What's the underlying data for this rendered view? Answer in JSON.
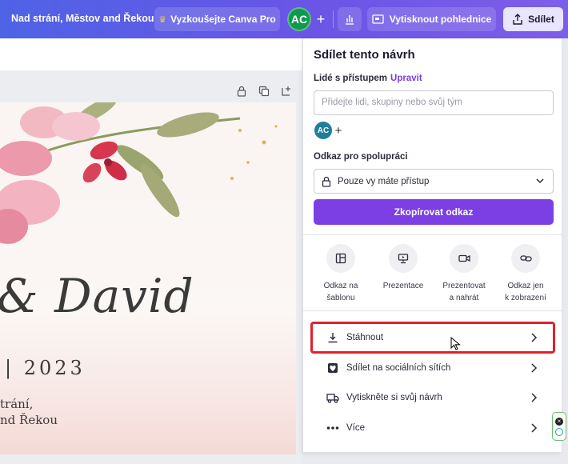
{
  "topbar": {
    "doc_title": "Nad strání, Městov and Řekou",
    "try_pro_label": "Vyzkoušejte Canva Pro",
    "avatar_initials": "AC",
    "print_label": "Vytisknout pohlednice",
    "share_label": "Sdílet",
    "accent_gradient": [
      "#4e63e6",
      "#7d5ee8"
    ]
  },
  "canvas": {
    "names_text": "& David",
    "date_text": "| 2023",
    "venue_line1": "trání,",
    "venue_line2": "nd Řekou"
  },
  "share_panel": {
    "title": "Sdílet tento návrh",
    "people_label": "Lidé s přístupem",
    "edit_link": "Upravit",
    "people_input_placeholder": "Přidejte lidi, skupiny nebo svůj tým",
    "collaborator_initials": "AC",
    "link_label": "Odkaz pro spolupráci",
    "access_value": "Pouze vy máte přístup",
    "copy_button": "Zkopírovat odkaz",
    "accent_color": "#7b3fe4",
    "options": [
      {
        "icon": "template-icon",
        "line1": "Odkaz na",
        "line2": "šablonu"
      },
      {
        "icon": "presentation-icon",
        "line1": "Prezentace",
        "line2": ""
      },
      {
        "icon": "video-camera-icon",
        "line1": "Prezentovat",
        "line2": "a nahrát"
      },
      {
        "icon": "link-icon",
        "line1": "Odkaz jen",
        "line2": "k zobrazení"
      }
    ],
    "rows": [
      {
        "icon": "download-icon",
        "label": "Stáhnout",
        "highlighted": true
      },
      {
        "icon": "heart-icon",
        "label": "Sdílet na sociálních sítích"
      },
      {
        "icon": "truck-icon",
        "label": "Vytiskněte si svůj návrh"
      },
      {
        "icon": "more-icon",
        "label": "Více"
      }
    ]
  }
}
